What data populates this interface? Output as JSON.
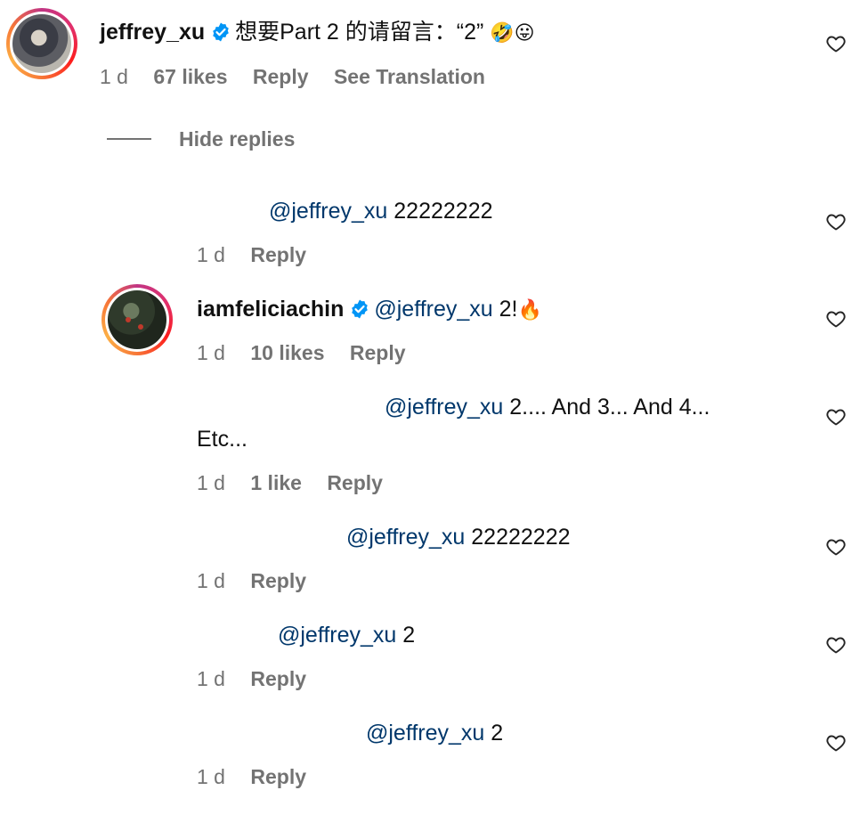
{
  "top_comment": {
    "username": "jeffrey_xu",
    "text": "想要Part 2 的请留言：“2”",
    "emojis": "🤣😛",
    "time": "1 d",
    "likes": "67 likes",
    "reply": "Reply",
    "translate": "See Translation"
  },
  "hide_replies": "Hide replies",
  "replies": [
    {
      "username": "",
      "mention": "@jeffrey_xu",
      "text": "22222222",
      "time": "1 d",
      "likes": "",
      "reply": "Reply"
    },
    {
      "username": "iamfeliciachin",
      "mention": "@jeffrey_xu",
      "text": "2!",
      "emoji": "🔥",
      "time": "1 d",
      "likes": "10 likes",
      "reply": "Reply"
    },
    {
      "username": "",
      "mention": "@jeffrey_xu",
      "text": "2.... And 3... And 4...",
      "text2": "Etc...",
      "time": "1 d",
      "likes": "1 like",
      "reply": "Reply"
    },
    {
      "username": "",
      "mention": "@jeffrey_xu",
      "text": "22222222",
      "time": "1 d",
      "likes": "",
      "reply": "Reply"
    },
    {
      "username": "",
      "mention": "@jeffrey_xu",
      "text": "2",
      "time": "1 d",
      "likes": "",
      "reply": "Reply"
    },
    {
      "username": "",
      "mention": "@jeffrey_xu",
      "text": "2",
      "time": "1 d",
      "likes": "",
      "reply": "Reply"
    }
  ],
  "icons": {
    "heart": "heart-outline-icon",
    "verified": "verified-badge-icon"
  },
  "colors": {
    "mention": "#00376b",
    "meta": "#737373",
    "verified": "#0095f6"
  }
}
